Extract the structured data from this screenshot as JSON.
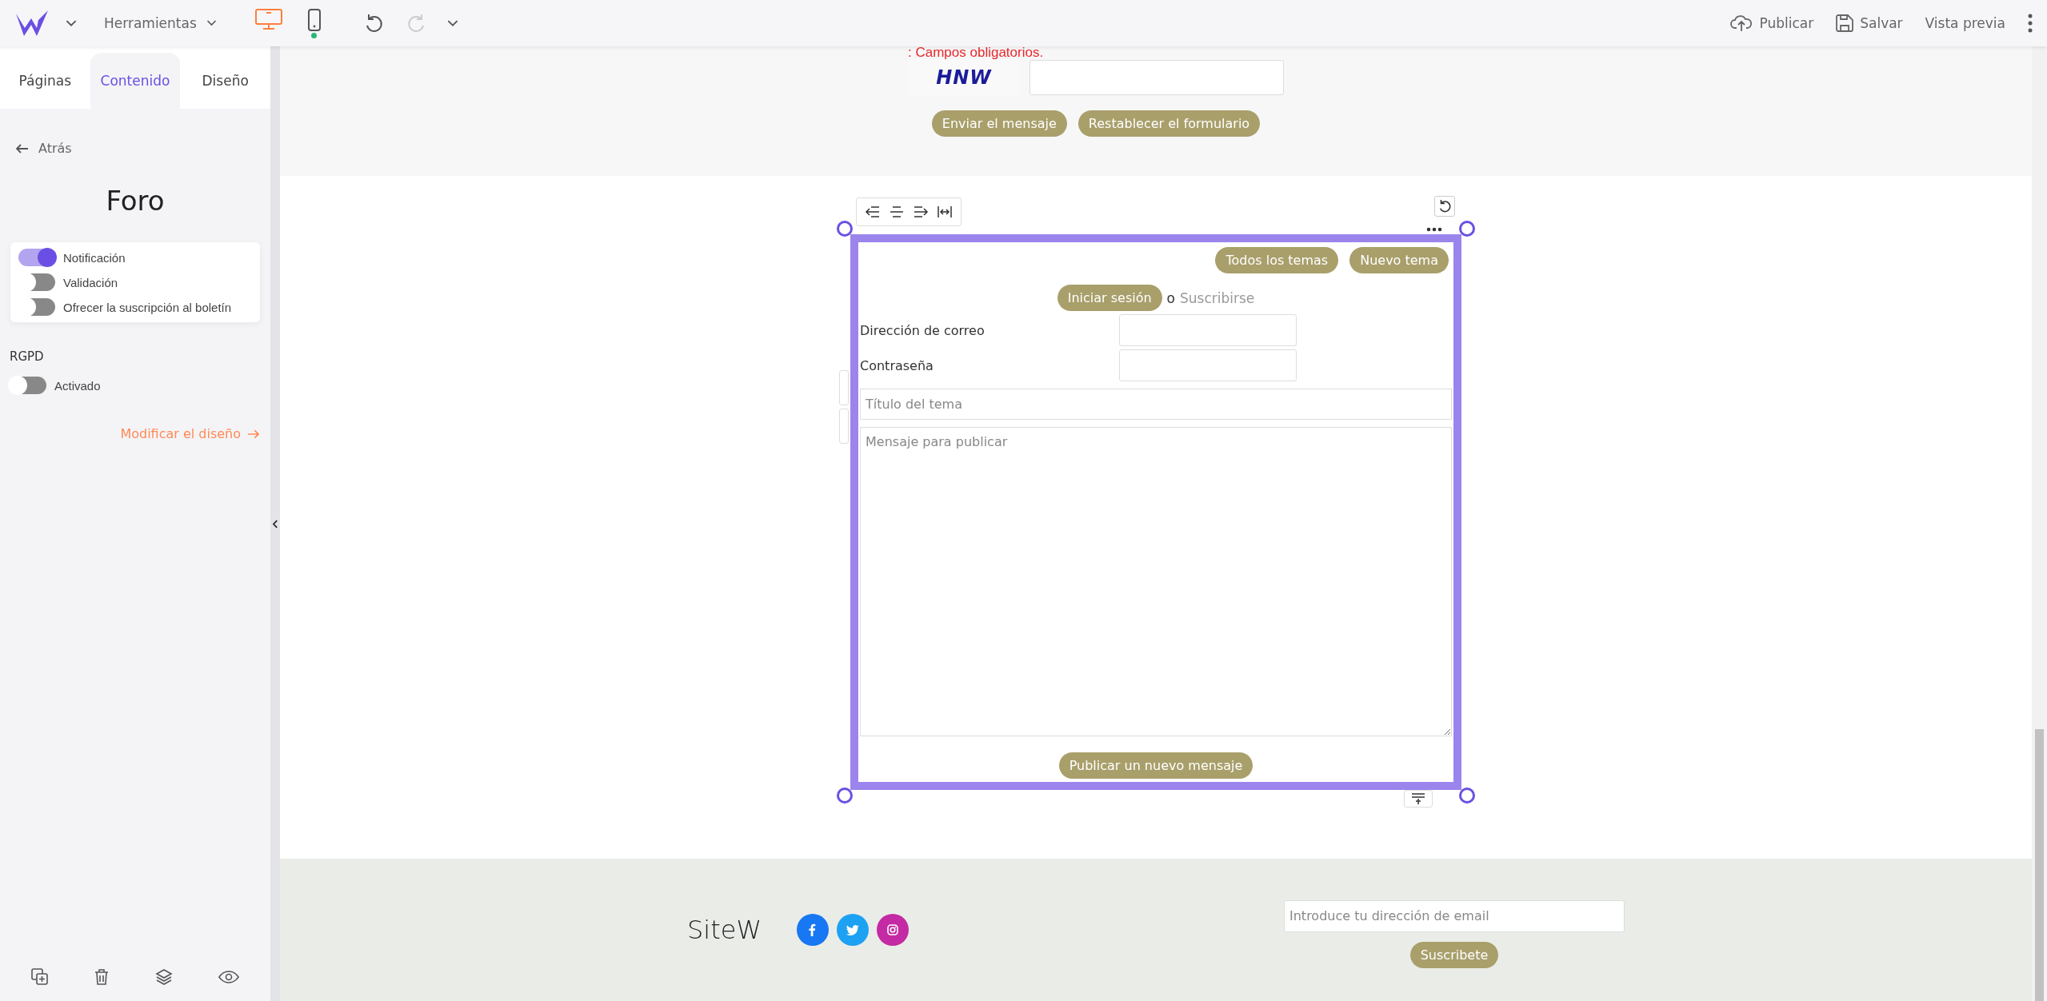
{
  "toolbar": {
    "menu": {
      "label": "Herramientas"
    },
    "devices": [
      {
        "kind": "desktop",
        "selected": true
      },
      {
        "kind": "mobile",
        "selected": false
      }
    ],
    "actions": [
      {
        "kind": "publish",
        "label": "Publicar"
      },
      {
        "kind": "save",
        "label": "Salvar"
      },
      {
        "kind": "preview",
        "label": "Vista previa"
      }
    ]
  },
  "sidebar": {
    "tabs": [
      {
        "label": "Páginas",
        "selected": false
      },
      {
        "label": "Contenido",
        "selected": true
      },
      {
        "label": "Diseño",
        "selected": false
      }
    ],
    "back_link": "Atrás",
    "title": "Foro",
    "options": [
      {
        "label": "Notificación",
        "on": true
      },
      {
        "label": "Validación",
        "on": false
      },
      {
        "label": "Ofrecer la suscripción al boletín",
        "on": false
      }
    ],
    "rgpd": {
      "heading": "RGPD",
      "label": "Activado",
      "on": false
    },
    "design_link": "Modificar el diseño"
  },
  "contact_form": {
    "required_note": ": Campos obligatorios.",
    "captcha_text": "HNW",
    "buttons": [
      "Enviar el mensaje",
      "Restablecer el formulario"
    ]
  },
  "forum": {
    "nav_buttons": [
      "Todos los temas",
      "Nuevo tema"
    ],
    "login_button": "Iniciar sesión",
    "separator": "o",
    "subscribe_link": "Suscribirse",
    "fields": [
      {
        "label": "Dirección de correo"
      },
      {
        "label": "Contraseña"
      }
    ],
    "topic_title": {
      "placeholder": "Título del tema"
    },
    "message": {
      "placeholder": "Mensaje para publicar"
    },
    "submit": "Publicar un nuevo mensaje"
  },
  "footer": {
    "brand": "SiteW",
    "social": [
      {
        "kind": "facebook",
        "color": "#1877f2"
      },
      {
        "kind": "twitter",
        "color": "#1da1f2"
      },
      {
        "kind": "instagram",
        "color": "#c32aa3"
      }
    ],
    "newsletter": {
      "placeholder": "Introduce tu dirección de email",
      "button": "Suscribete"
    }
  }
}
